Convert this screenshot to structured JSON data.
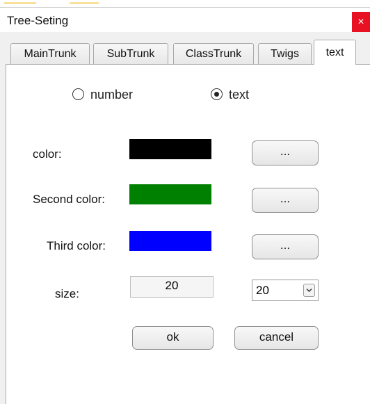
{
  "window": {
    "title": "Tree-Seting",
    "close_glyph": "×"
  },
  "tabs": [
    {
      "label": "MainTrunk",
      "active": false
    },
    {
      "label": "SubTrunk",
      "active": false
    },
    {
      "label": "ClassTrunk",
      "active": false
    },
    {
      "label": "Twigs",
      "active": false
    },
    {
      "label": "text",
      "active": true
    }
  ],
  "mode": {
    "options": [
      {
        "label": "number",
        "checked": false
      },
      {
        "label": "text",
        "checked": true
      }
    ]
  },
  "colors": {
    "color_label": "color:",
    "second_label": "Second color:",
    "third_label": "Third color:",
    "values": [
      "#000000",
      "#008000",
      "#0000ff"
    ],
    "picker_label": "..."
  },
  "size": {
    "label": "size:",
    "value": "20",
    "select_value": "20"
  },
  "buttons": {
    "ok": "ok",
    "cancel": "cancel"
  }
}
